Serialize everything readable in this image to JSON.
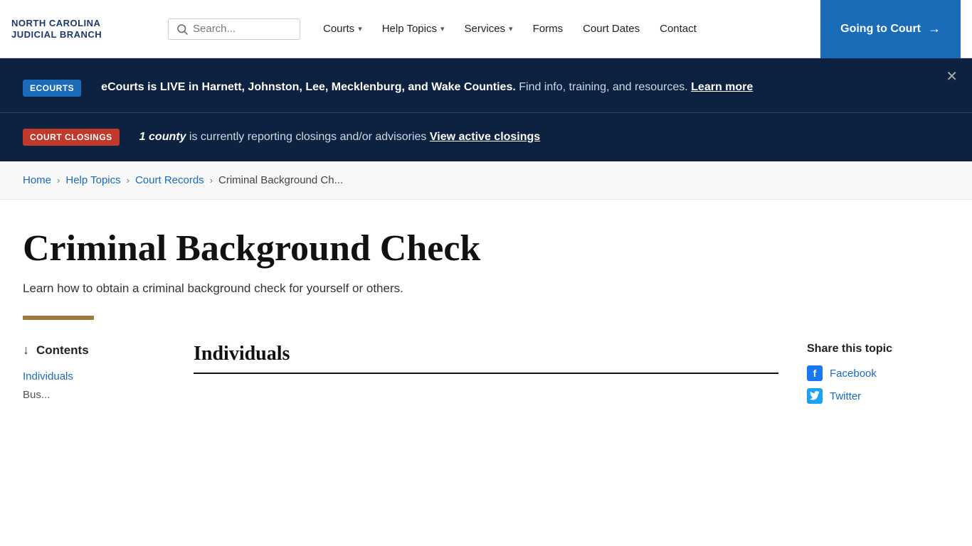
{
  "header": {
    "logo_line1": "NORTH CAROLINA",
    "logo_line2": "JUDICIAL BRANCH",
    "search_placeholder": "Search...",
    "nav_items": [
      {
        "label": "Courts",
        "has_dropdown": true
      },
      {
        "label": "Help Topics",
        "has_dropdown": true
      },
      {
        "label": "Services",
        "has_dropdown": true
      },
      {
        "label": "Forms",
        "has_dropdown": false
      },
      {
        "label": "Court Dates",
        "has_dropdown": false
      },
      {
        "label": "Contact",
        "has_dropdown": false
      }
    ],
    "cta_label": "Going to Court",
    "cta_arrow": "→"
  },
  "ecourts_banner": {
    "badge": "ECOURTS",
    "text_bold": "eCourts is LIVE in Harnett, Johnston, Lee, Mecklenburg, and Wake Counties.",
    "text_normal": " Find info, training, and resources. ",
    "link_text": "Learn more"
  },
  "closings_banner": {
    "badge": "COURT CLOSINGS",
    "text_bold": "1 county",
    "text_normal": " is currently reporting closings and/or advisories ",
    "link_text": "View active closings"
  },
  "breadcrumb": {
    "items": [
      {
        "label": "Home",
        "href": true
      },
      {
        "label": "Help Topics",
        "href": true
      },
      {
        "label": "Court Records",
        "href": true
      },
      {
        "label": "Criminal Background Ch...",
        "href": false
      }
    ]
  },
  "page": {
    "title": "Criminal Background Check",
    "subtitle": "Learn how to obtain a criminal background check for yourself or others."
  },
  "contents": {
    "heading": "Contents",
    "items": [
      {
        "label": "Individuals",
        "href": true
      },
      {
        "label": "Bus...",
        "href": false
      }
    ]
  },
  "section": {
    "heading": "Individuals"
  },
  "share": {
    "heading": "Share this topic",
    "facebook_label": "Facebook",
    "twitter_label": "Twitter"
  }
}
